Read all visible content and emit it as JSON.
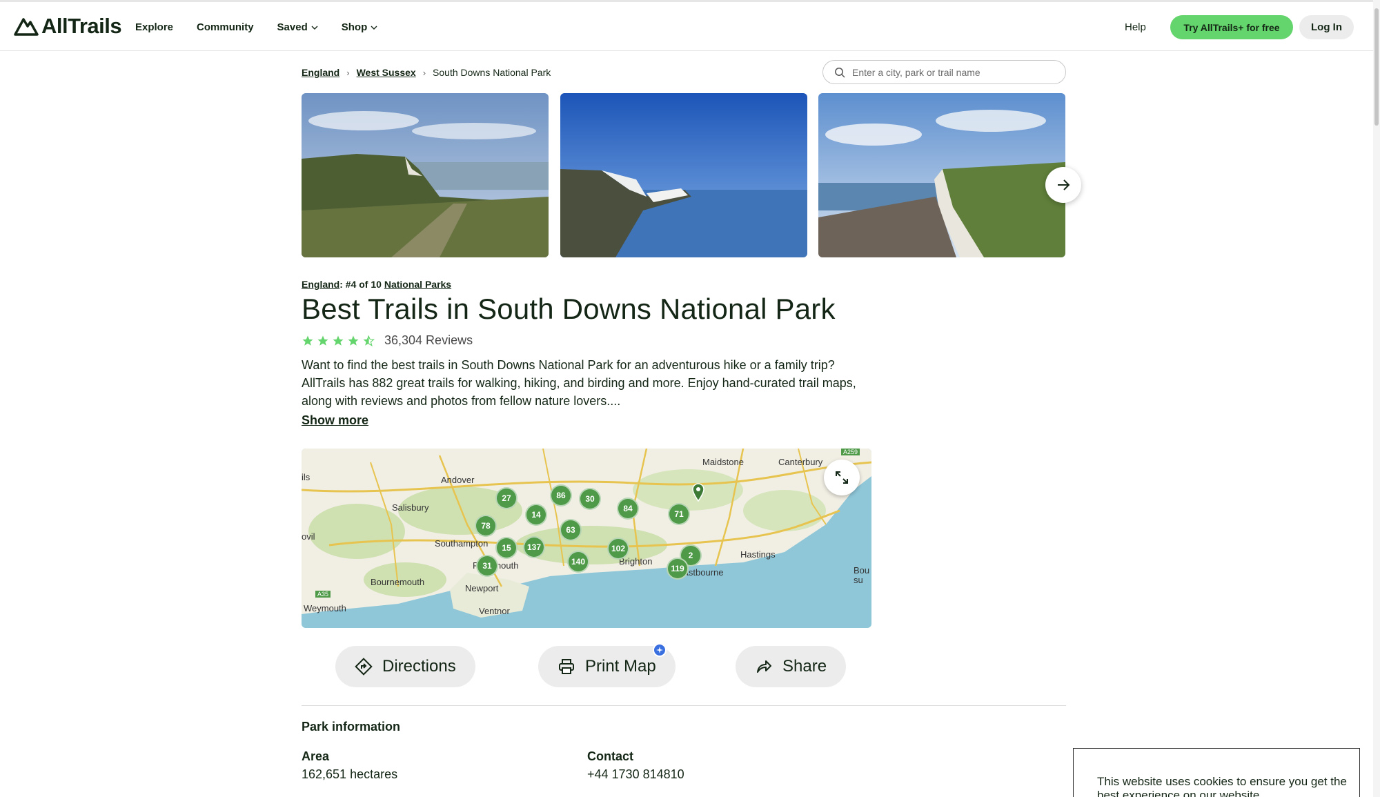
{
  "header": {
    "logo_text": "AllTrails",
    "nav": [
      {
        "label": "Explore",
        "dropdown": false
      },
      {
        "label": "Community",
        "dropdown": false
      },
      {
        "label": "Saved",
        "dropdown": true
      },
      {
        "label": "Shop",
        "dropdown": true
      }
    ],
    "help_label": "Help",
    "try_button_label": "Try AllTrails+ for free",
    "login_label": "Log In",
    "accent_color": "#64d46c"
  },
  "breadcrumb": [
    "England",
    "West Sussex",
    "South Downs National Park"
  ],
  "search": {
    "placeholder": "Enter a city, park or trail name"
  },
  "ranking": {
    "region": "England",
    "rank_text": ": #4 of 10 ",
    "category": "National Parks"
  },
  "title": "Best Trails in South Downs National Park",
  "rating": {
    "stars": 4.5,
    "reviews_text": "36,304 Reviews"
  },
  "description": "Want to find the best trails in South Downs National Park for an adventurous hike or a family trip? AllTrails has 882 great trails for walking, hiking, and birding and more. Enjoy hand-curated trail maps, along with reviews and photos from fellow nature lovers....",
  "show_more_label": "Show more",
  "map": {
    "place_labels": [
      "Maidstone",
      "Canterbury",
      "Andover",
      "Salisbury",
      "Southampton",
      "Portsmouth",
      "Brighton",
      "Hastings",
      "Eastbourne",
      "Bournemouth",
      "Newport",
      "Ventnor",
      "Weymouth",
      "Bou su",
      "ils",
      "ovil"
    ],
    "clusters": [
      "27",
      "86",
      "30",
      "14",
      "84",
      "71",
      "78",
      "63",
      "15",
      "137",
      "102",
      "2",
      "140",
      "31",
      "119"
    ],
    "road_tags": [
      "A259",
      "A35"
    ]
  },
  "actions": {
    "directions_label": "Directions",
    "print_label": "Print Map",
    "share_label": "Share"
  },
  "park_info": {
    "heading": "Park information",
    "area_label": "Area",
    "area_value": "162,651 hectares",
    "contact_label": "Contact",
    "contact_value": "+44 1730 814810"
  },
  "cookie_text": "This website uses cookies to ensure you get the best experience on our website."
}
